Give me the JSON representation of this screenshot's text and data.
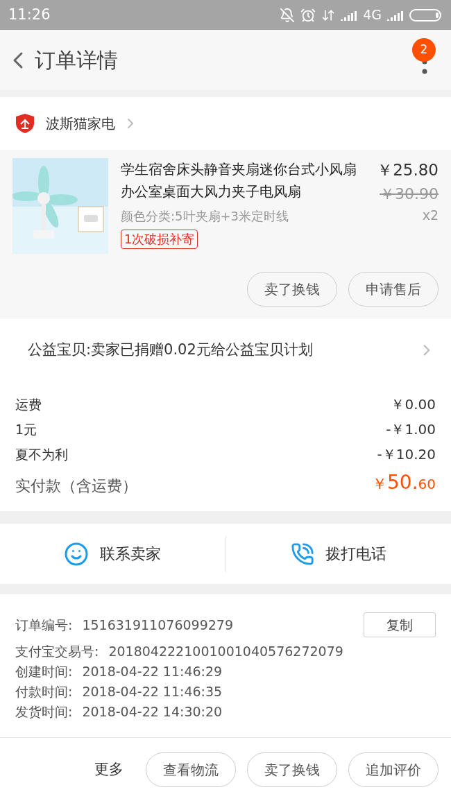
{
  "status_bar": {
    "time": "11:26",
    "network": "4G"
  },
  "header": {
    "title": "订单详情",
    "badge": "2"
  },
  "shop": {
    "name": "波斯猫家电"
  },
  "item": {
    "title": "学生宿舍床头静音夹扇迷你台式小风扇办公室桌面大风力夹子电风扇",
    "price": "￥25.80",
    "original_price": "￥30.90",
    "quantity": "x2",
    "spec": "颜色分类:5叶夹扇+3米定时线",
    "tag": "1次破损补寄",
    "actions": [
      "卖了换钱",
      "申请售后"
    ]
  },
  "charity": {
    "text": "公益宝贝:卖家已捐赠0.02元给公益宝贝计划"
  },
  "fees": [
    {
      "label": "运费",
      "value": "￥0.00"
    },
    {
      "label": "1元",
      "value": "-￥1.00"
    },
    {
      "label": "夏不为利",
      "value": "-￥10.20"
    }
  ],
  "total": {
    "label": "实付款（含运费）",
    "currency": "￥",
    "integer": "50.",
    "decimal": "60"
  },
  "contact": [
    "联系卖家",
    "拨打电话"
  ],
  "order_info": {
    "copy_button": "复制",
    "rows": [
      {
        "label": "订单编号:",
        "value": "151631911076099279"
      },
      {
        "label": "支付宝交易号:",
        "value": "2018042221001001040576272079"
      },
      {
        "label": "创建时间:",
        "value": "2018-04-22 11:46:29"
      },
      {
        "label": "付款时间:",
        "value": "2018-04-22 11:46:35"
      },
      {
        "label": "发货时间:",
        "value": "2018-04-22 14:30:20"
      }
    ]
  },
  "bottom_bar": {
    "more": "更多",
    "buttons": [
      "查看物流",
      "卖了换钱",
      "追加评价"
    ]
  }
}
